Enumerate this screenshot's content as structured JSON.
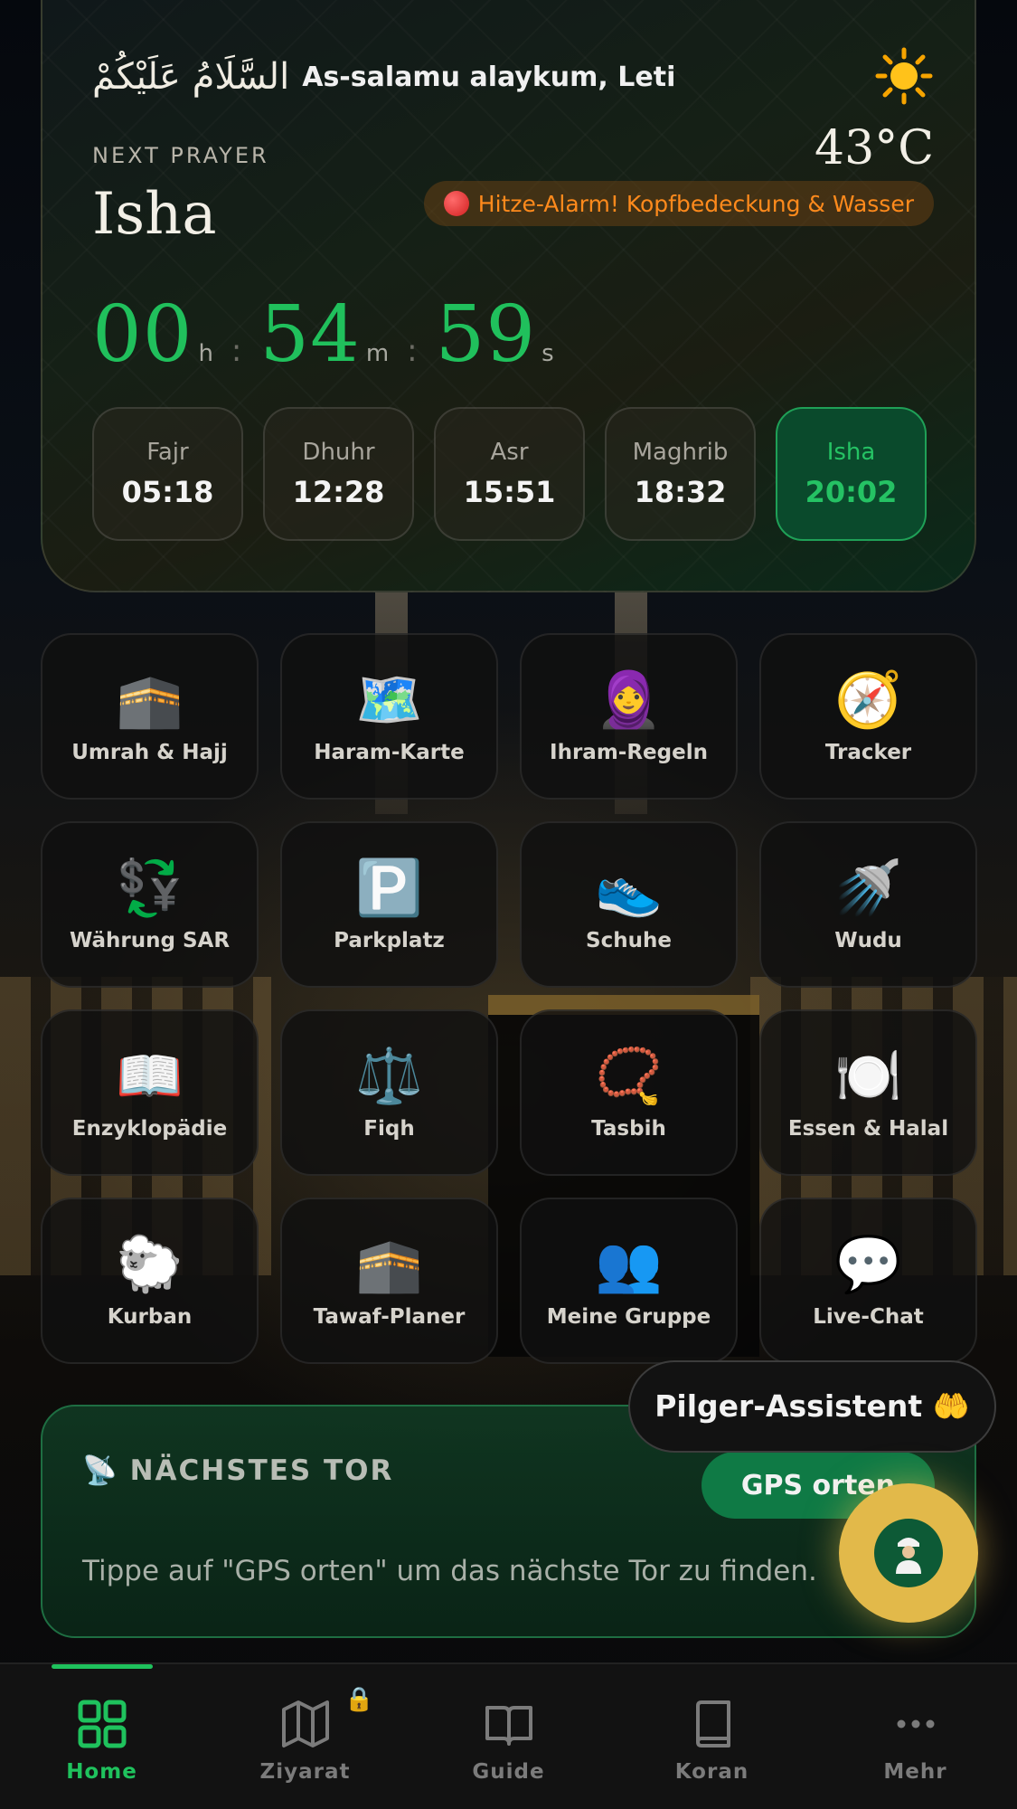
{
  "header": {
    "greeting_arabic": "السَّلَامُ عَلَيْكُمْ",
    "greeting": "As-salamu alaykum, Leti",
    "weather_icon": "sun-icon",
    "temperature": "43°C",
    "heat_alert": "Hitze-Alarm! Kopfbedeckung & Wasser"
  },
  "prayer": {
    "next_label": "NEXT PRAYER",
    "next_name": "Isha",
    "countdown": {
      "hours": "00",
      "minutes": "54",
      "seconds": "59",
      "h": "h",
      "m": "m",
      "s": "s"
    },
    "times": [
      {
        "name": "Fajr",
        "time": "05:18"
      },
      {
        "name": "Dhuhr",
        "time": "12:28"
      },
      {
        "name": "Asr",
        "time": "15:51"
      },
      {
        "name": "Maghrib",
        "time": "18:32"
      },
      {
        "name": "Isha",
        "time": "20:02",
        "active": true
      }
    ]
  },
  "tiles": [
    {
      "label": "Umrah & Hajj",
      "icon": "🕋"
    },
    {
      "label": "Haram-Karte",
      "icon": "🗺️"
    },
    {
      "label": "Ihram-Regeln",
      "icon": "🧕"
    },
    {
      "label": "Tracker",
      "icon": "🧭"
    },
    {
      "label": "Währung SAR",
      "icon": "💱"
    },
    {
      "label": "Parkplatz",
      "icon": "🅿️"
    },
    {
      "label": "Schuhe",
      "icon": "👟"
    },
    {
      "label": "Wudu",
      "icon": "🚿"
    },
    {
      "label": "Enzyklopädie",
      "icon": "📖"
    },
    {
      "label": "Fiqh",
      "icon": "⚖️"
    },
    {
      "label": "Tasbih",
      "icon": "📿"
    },
    {
      "label": "Essen & Halal",
      "icon": "🍽️"
    },
    {
      "label": "Kurban",
      "icon": "🐑"
    },
    {
      "label": "Tawaf-Planer",
      "icon": "🕋"
    },
    {
      "label": "Meine Gruppe",
      "icon": "👥"
    },
    {
      "label": "Live-Chat",
      "icon": "💬"
    }
  ],
  "gate": {
    "icon": "📡",
    "title": "NÄCHSTES TOR",
    "button": "GPS orten",
    "hint": "Tippe auf \"GPS orten\" um das nächste Tor zu finden."
  },
  "assistant": {
    "label": "Pilger-Assistent 🤲"
  },
  "nav": {
    "items": [
      {
        "label": "Home",
        "icon": "grid-icon",
        "active": true
      },
      {
        "label": "Ziyarat",
        "icon": "map-icon",
        "locked": true
      },
      {
        "label": "Guide",
        "icon": "open-book-icon"
      },
      {
        "label": "Koran",
        "icon": "book-icon"
      },
      {
        "label": "Mehr",
        "icon": "more-icon"
      }
    ]
  },
  "colors": {
    "accent": "#1fc25d",
    "alert": "#ff8a1c",
    "fab": "#e2b94a"
  }
}
